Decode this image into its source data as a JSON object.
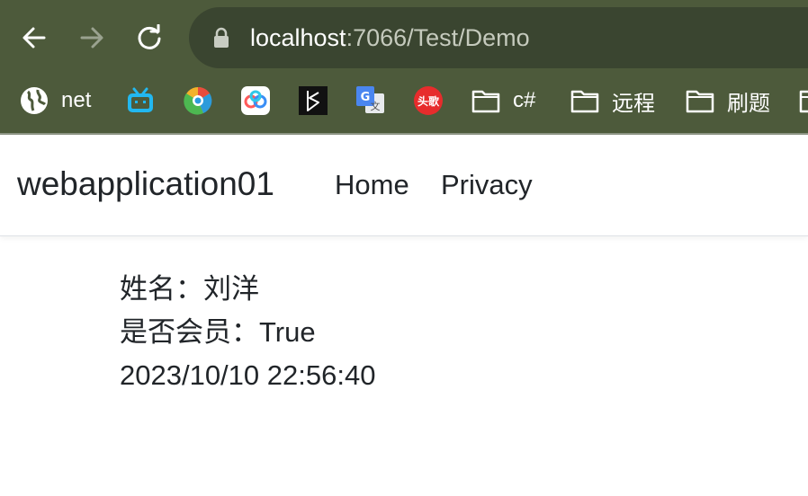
{
  "browser": {
    "url_host": "localhost",
    "url_path": ":7066/Test/Demo",
    "bookmarks": [
      {
        "icon": "globe-icon",
        "label": "net"
      },
      {
        "icon": "bilibili-icon",
        "label": ""
      },
      {
        "icon": "chrome-app-icon",
        "label": ""
      },
      {
        "icon": "baidu-netdisk-icon",
        "label": ""
      },
      {
        "icon": "black-app-icon",
        "label": ""
      },
      {
        "icon": "google-translate-icon",
        "label": ""
      },
      {
        "icon": "toutiao-icon",
        "label": "头歌"
      },
      {
        "icon": "folder-icon",
        "label": "c#"
      },
      {
        "icon": "folder-icon",
        "label": "远程"
      },
      {
        "icon": "folder-icon",
        "label": "刷题"
      }
    ]
  },
  "app": {
    "brand": "webapplication01",
    "nav": {
      "home": "Home",
      "privacy": "Privacy"
    }
  },
  "content": {
    "name_line": "姓名：刘洋",
    "member_line": "是否会员：True",
    "datetime_line": "2023/10/10 22:56:40"
  },
  "colors": {
    "chrome_bg": "#4d5a3b",
    "omnibox_bg": "#3a4530",
    "text": "#212529"
  }
}
